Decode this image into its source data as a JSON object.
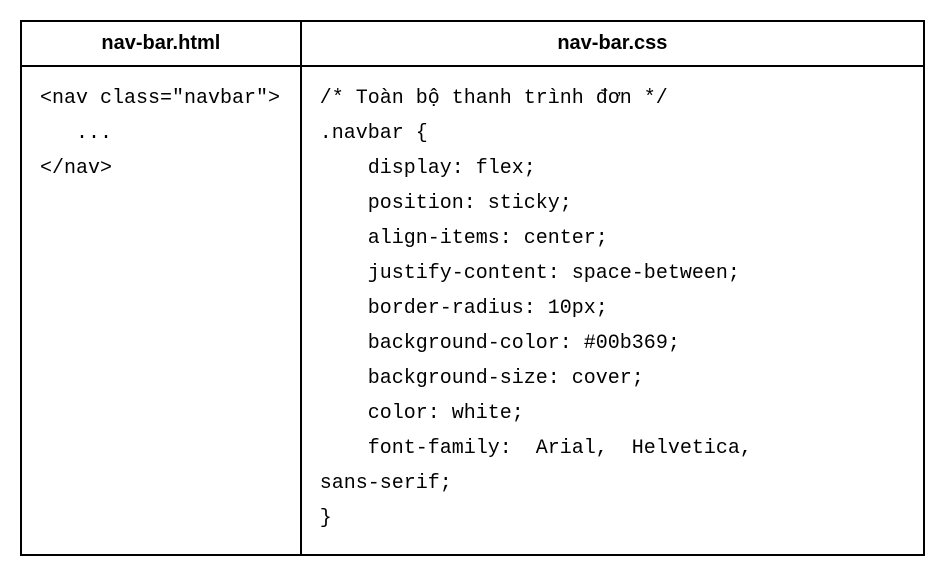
{
  "table": {
    "headers": {
      "html": "nav-bar.html",
      "css": "nav-bar.css"
    },
    "cells": {
      "html_code": "<nav class=\"navbar\">\n   ...\n</nav>",
      "css_code": "/* Toàn bộ thanh trình đơn */\n.navbar {\n    display: flex;\n    position: sticky;\n    align-items: center;\n    justify-content: space-between;\n    border-radius: 10px;\n    background-color: #00b369;\n    background-size: cover;\n    color: white;\n    font-family:  Arial,  Helvetica,\nsans-serif;\n}"
    }
  }
}
